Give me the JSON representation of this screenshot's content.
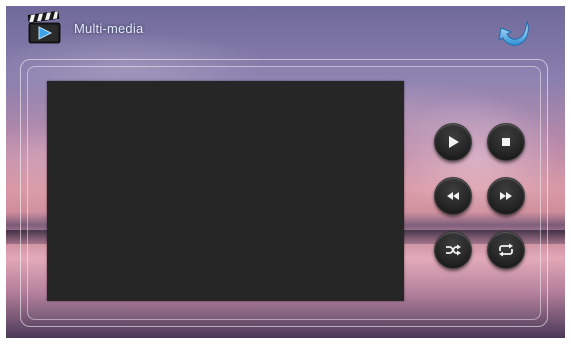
{
  "header": {
    "title": "Multi-media",
    "app_icon": "clapperboard-play-icon",
    "back_icon": "back-arrow-icon"
  },
  "player": {
    "video_area": "",
    "controls": [
      {
        "name": "play-button",
        "icon": "play-icon"
      },
      {
        "name": "stop-button",
        "icon": "stop-icon"
      },
      {
        "name": "rewind-button",
        "icon": "rewind-icon"
      },
      {
        "name": "fast-forward-button",
        "icon": "fast-forward-icon"
      },
      {
        "name": "shuffle-button",
        "icon": "shuffle-icon"
      },
      {
        "name": "repeat-button",
        "icon": "repeat-icon"
      }
    ]
  },
  "colors": {
    "title_text": "#dfe9ff",
    "video_bg": "#262626",
    "button_bg": "#262626",
    "accent_blue": "#3da1e6"
  }
}
